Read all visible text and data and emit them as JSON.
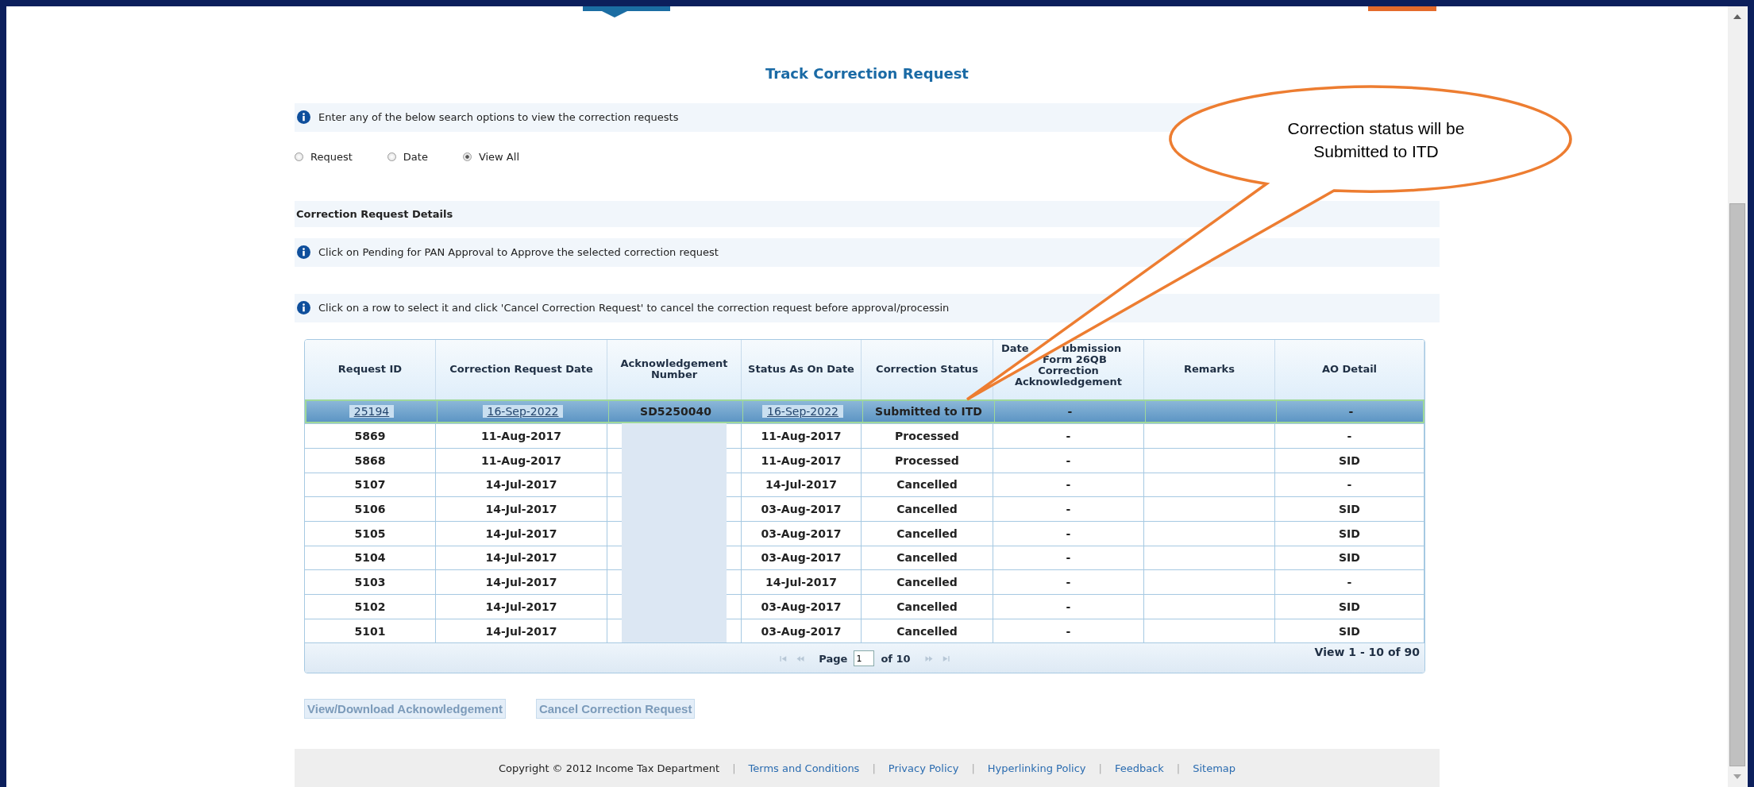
{
  "title": "Track Correction Request",
  "search_info": "Enter any of the below search options to view the correction requests",
  "search_options": [
    {
      "label": "Request",
      "selected": false
    },
    {
      "label": "Date",
      "selected": false
    },
    {
      "label": "View All",
      "selected": true
    }
  ],
  "section_title": "Correction Request Details",
  "info_messages": [
    "Click on Pending for PAN Approval to Approve the selected correction request",
    "Click on a row to select it and click 'Cancel Correction Request' to cancel the correction request before approval/processin"
  ],
  "table": {
    "columns": [
      {
        "kind": "plain",
        "label": "Request ID"
      },
      {
        "kind": "plain",
        "label": "Correction Request Date"
      },
      {
        "kind": "plain",
        "label": "Acknowledgement Number"
      },
      {
        "kind": "plain",
        "label": "Status As On Date"
      },
      {
        "kind": "plain",
        "label": "Correction Status"
      },
      {
        "kind": "covered",
        "lines": [
          [
            "Date",
            "ubmission"
          ],
          [
            "Form 26QB"
          ],
          [
            "Correction"
          ],
          [
            "Acknowledgement"
          ]
        ]
      },
      {
        "kind": "plain",
        "label": "Remarks"
      },
      {
        "kind": "plain",
        "label": "AO Detail"
      }
    ],
    "rows": [
      {
        "selected": true,
        "links": true,
        "id": "25194",
        "request_date": "16-Sep-2022",
        "ack": "SD5250040",
        "status_date": "16-Sep-2022",
        "status": "Submitted to ITD",
        "submission_date": "-",
        "ao_detail": "-"
      },
      {
        "selected": false,
        "links": false,
        "id": "5869",
        "request_date": "11-Aug-2017",
        "ack_redacted": true,
        "status_date": "11-Aug-2017",
        "status": "Processed",
        "submission_date": "-",
        "ao_detail": "-"
      },
      {
        "selected": false,
        "links": false,
        "id": "5868",
        "request_date": "11-Aug-2017",
        "ack_redacted": true,
        "status_date": "11-Aug-2017",
        "status": "Processed",
        "submission_date": "-",
        "ao_detail": "SID"
      },
      {
        "selected": false,
        "links": false,
        "id": "5107",
        "request_date": "14-Jul-2017",
        "ack_redacted": true,
        "status_date": "14-Jul-2017",
        "status": "Cancelled",
        "submission_date": "-",
        "ao_detail": "-"
      },
      {
        "selected": false,
        "links": false,
        "id": "5106",
        "request_date": "14-Jul-2017",
        "ack_redacted": true,
        "status_date": "03-Aug-2017",
        "status": "Cancelled",
        "submission_date": "-",
        "ao_detail": "SID"
      },
      {
        "selected": false,
        "links": false,
        "id": "5105",
        "request_date": "14-Jul-2017",
        "ack_redacted": true,
        "status_date": "03-Aug-2017",
        "status": "Cancelled",
        "submission_date": "-",
        "ao_detail": "SID"
      },
      {
        "selected": false,
        "links": false,
        "id": "5104",
        "request_date": "14-Jul-2017",
        "ack_redacted": true,
        "status_date": "03-Aug-2017",
        "status": "Cancelled",
        "submission_date": "-",
        "ao_detail": "SID"
      },
      {
        "selected": false,
        "links": false,
        "id": "5103",
        "request_date": "14-Jul-2017",
        "ack_redacted": true,
        "status_date": "14-Jul-2017",
        "status": "Cancelled",
        "submission_date": "-",
        "ao_detail": "-"
      },
      {
        "selected": false,
        "links": false,
        "id": "5102",
        "request_date": "14-Jul-2017",
        "ack_redacted": true,
        "status_date": "03-Aug-2017",
        "status": "Cancelled",
        "submission_date": "-",
        "ao_detail": "SID"
      },
      {
        "selected": false,
        "links": false,
        "id": "5101",
        "request_date": "14-Jul-2017",
        "ack_redacted": true,
        "status_date": "03-Aug-2017",
        "status": "Cancelled",
        "submission_date": "-",
        "ao_detail": "SID"
      }
    ]
  },
  "pager": {
    "page_label": "Page",
    "page": "1",
    "of": "of 10",
    "summary": "View 1 - 10 of 90"
  },
  "buttons": [
    "View/Download Acknowledgement",
    "Cancel Correction Request"
  ],
  "footer": {
    "copyright": "Copyright © 2012 Income Tax Department",
    "links": [
      {
        "separator": "|",
        "label": "Terms and Conditions"
      },
      {
        "separator": "|",
        "label": "Privacy Policy"
      },
      {
        "separator": "|",
        "label": "Hyperlinking Policy"
      },
      {
        "separator": "|",
        "label": "Feedback"
      },
      {
        "separator": "|",
        "label": "Sitemap"
      }
    ]
  },
  "callout": {
    "lines": [
      "Correction status will be",
      "Submitted to ITD"
    ]
  }
}
